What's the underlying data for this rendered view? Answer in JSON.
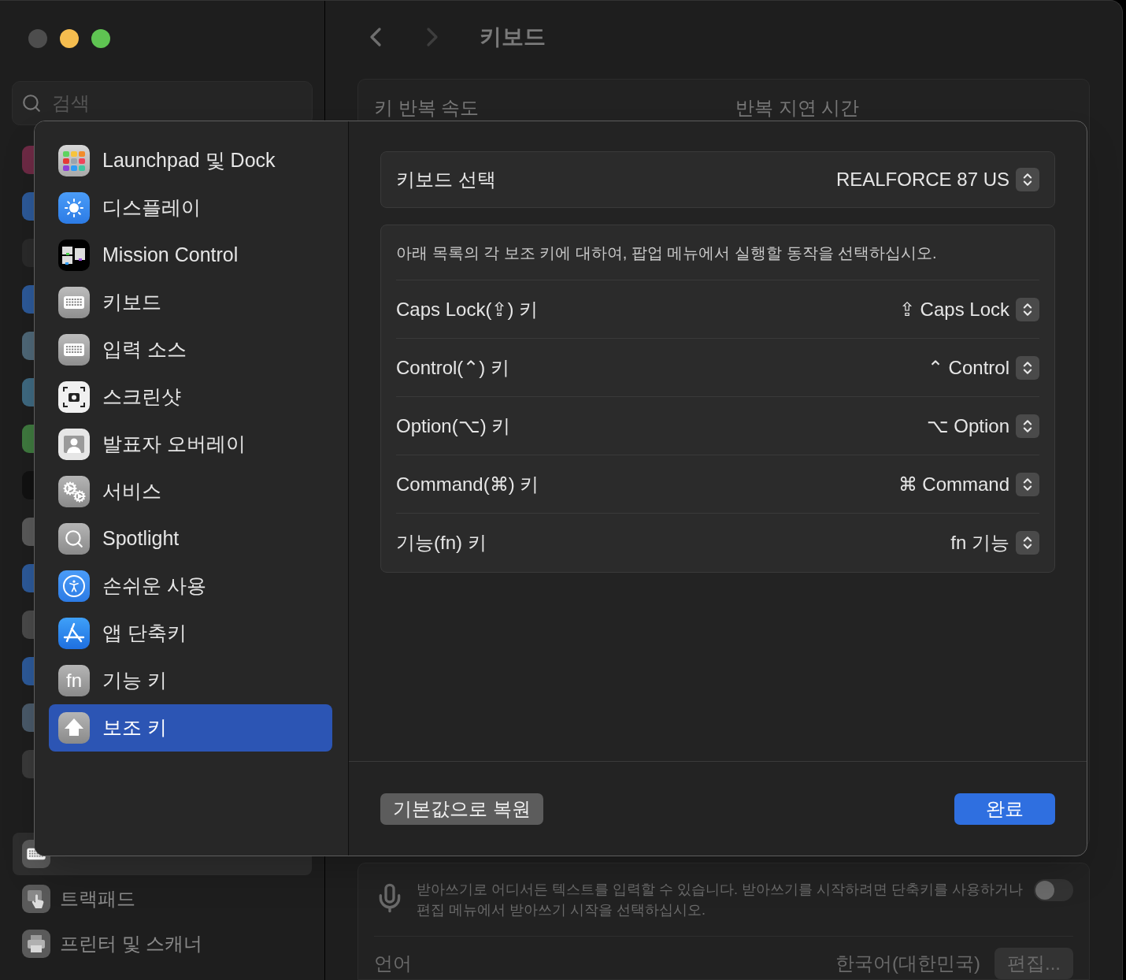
{
  "sidebar": {
    "search": {
      "placeholder": "검색"
    },
    "obscured_icons": [
      {
        "color": "#6e2a45"
      },
      {
        "color": "#2d5a9a"
      },
      {
        "color": "#2a2a2a"
      },
      {
        "color": "#2d5a9a"
      },
      {
        "color": "#4f6878"
      },
      {
        "color": "#3f6a82"
      },
      {
        "color": "#3f7a3f"
      },
      {
        "color": "#111111"
      },
      {
        "color": "#5a5a5a"
      },
      {
        "color": "#2d5a9a"
      },
      {
        "color": "#4a4a4a"
      },
      {
        "color": "#2d5a9a"
      },
      {
        "color": "#4a5a6a"
      },
      {
        "color": "#3a3a3a"
      }
    ],
    "items": [
      {
        "kind": "keyboard",
        "selected": true
      },
      {
        "kind": "trackpad",
        "label": "트랙패드",
        "selected": false
      },
      {
        "kind": "printer",
        "label": "프린터 및 스캐너",
        "selected": false
      }
    ]
  },
  "header": {
    "title": "키보드",
    "nav": [
      {
        "kind": "back",
        "disabled": false
      },
      {
        "kind": "forward",
        "disabled": true
      }
    ]
  },
  "keyboard_card": {
    "left_label": "키 반복 속도",
    "right_label": "반복 지연 시간"
  },
  "dictation_card": {
    "text": "받아쓰기로 어디서든 텍스트를 입력할 수 있습니다. 받아쓰기를 시작하려면 단축키를 사용하거나 편집 메뉴에서 받아쓰기 시작을 선택하십시오.",
    "on": false,
    "language_label": "언어",
    "language_value": "한국어(대한민국)",
    "edit_button": "편집..."
  },
  "sheet": {
    "sidebar": [
      {
        "kind": "launchpad",
        "label": "Launchpad 및 Dock",
        "selected": false
      },
      {
        "kind": "display",
        "label": "디스플레이",
        "selected": false
      },
      {
        "kind": "mission_control",
        "label": "Mission Control",
        "selected": false
      },
      {
        "kind": "keyboard",
        "label": "키보드",
        "selected": false
      },
      {
        "kind": "keyboard",
        "label": "입력 소스",
        "selected": false
      },
      {
        "kind": "screenshot",
        "label": "스크린샷",
        "selected": false
      },
      {
        "kind": "presenter",
        "label": "발표자 오버레이",
        "selected": false
      },
      {
        "kind": "services",
        "label": "서비스",
        "selected": false
      },
      {
        "kind": "spotlight",
        "label": "Spotlight",
        "selected": false
      },
      {
        "kind": "accessibility",
        "label": "손쉬운 사용",
        "selected": false
      },
      {
        "kind": "app_shortcuts",
        "label": "앱 단축키",
        "selected": false
      },
      {
        "kind": "fn",
        "label": "기능 키",
        "icon_text": "fn",
        "selected": false
      },
      {
        "kind": "modifier",
        "label": "보조 키",
        "selected": true
      }
    ],
    "keyboard_select": {
      "label": "키보드 선택",
      "value": "REALFORCE 87 US"
    },
    "description": "아래 목록의 각 보조 키에 대하여, 팝업 메뉴에서 실행할 동작을 선택하십시오.",
    "modifiers": [
      {
        "label": "Caps Lock(⇪) 키",
        "value": "⇪ Caps Lock"
      },
      {
        "label": "Control(⌃) 키",
        "value": "⌃ Control"
      },
      {
        "label": "Option(⌥) 키",
        "value": "⌥ Option"
      },
      {
        "label": "Command(⌘) 키",
        "value": "⌘ Command"
      },
      {
        "label": "기능(fn) 키",
        "value": "fn 기능"
      }
    ],
    "buttons": [
      {
        "kind": "secondary",
        "label": "기본값으로 복원"
      },
      {
        "kind": "primary",
        "label": "완료"
      }
    ]
  }
}
